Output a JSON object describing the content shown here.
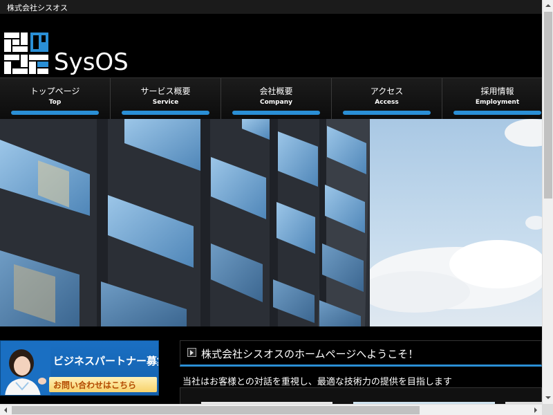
{
  "topbar": {
    "text": "株式会社シスオス"
  },
  "logo": {
    "text": "SysOS"
  },
  "nav": {
    "items": [
      {
        "jp": "トップページ",
        "en": "Top"
      },
      {
        "jp": "サービス概要",
        "en": "Service"
      },
      {
        "jp": "会社概要",
        "en": "Company"
      },
      {
        "jp": "アクセス",
        "en": "Access"
      },
      {
        "jp": "採用情報",
        "en": "Employment"
      }
    ],
    "accent": "#2a8fd6"
  },
  "banner": {
    "title": "ビジネスパートナー募集",
    "subtitle": "お問い合わせはこちら"
  },
  "welcome": {
    "title": "株式会社シスオスのホームページへようこそ！"
  },
  "intro": {
    "text": "当社はお客様との対話を重視し、最適な技術力の提供を目指します"
  },
  "colors": {
    "background": "#000000",
    "accent": "#2a8fd6",
    "banner": "#1a6fc2"
  },
  "icons": {
    "welcome_bullet": "arrow-right-icon"
  }
}
